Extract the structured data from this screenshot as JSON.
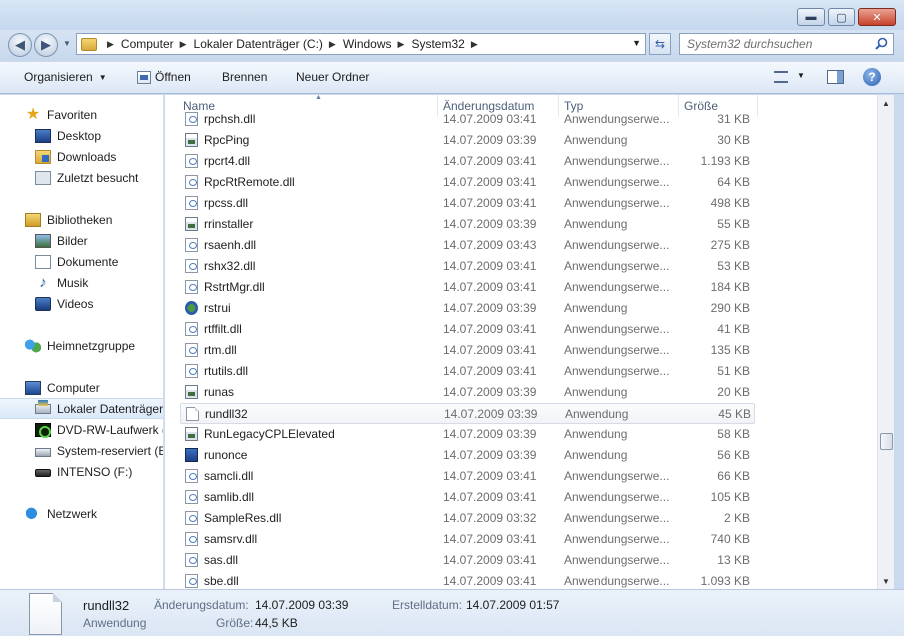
{
  "window": {
    "min_glyph": "▬",
    "max_glyph": "▢",
    "close_glyph": "✕"
  },
  "address": {
    "crumbs": [
      "Computer",
      "Lokaler Datenträger (C:)",
      "Windows",
      "System32"
    ],
    "search_placeholder": "System32 durchsuchen"
  },
  "toolbar": {
    "organize": "Organisieren",
    "open": "Öffnen",
    "burn": "Brennen",
    "new_folder": "Neuer Ordner",
    "help": "?"
  },
  "sidebar": {
    "favorites": "Favoriten",
    "desktop": "Desktop",
    "downloads": "Downloads",
    "recent": "Zuletzt besucht",
    "libraries": "Bibliotheken",
    "pictures": "Bilder",
    "documents": "Dokumente",
    "music": "Musik",
    "videos": "Videos",
    "homegroup": "Heimnetzgruppe",
    "computer": "Computer",
    "drive_c": "Lokaler Datenträger",
    "drive_dvd": "DVD-RW-Laufwerk (",
    "drive_sys": "System-reserviert (E:",
    "drive_f": "INTENSO (F:)",
    "network": "Netzwerk"
  },
  "columns": {
    "name": "Name",
    "date": "Änderungsdatum",
    "type": "Typ",
    "size": "Größe"
  },
  "files": [
    {
      "name": "rpchsh.dll",
      "date": "14.07.2009 03:41",
      "type": "Anwendungserwe...",
      "size": "31 KB",
      "icon": "dll-icon"
    },
    {
      "name": "RpcPing",
      "date": "14.07.2009 03:39",
      "type": "Anwendung",
      "size": "30 KB",
      "icon": "exe-icon"
    },
    {
      "name": "rpcrt4.dll",
      "date": "14.07.2009 03:41",
      "type": "Anwendungserwe...",
      "size": "1.193 KB",
      "icon": "dll-icon"
    },
    {
      "name": "RpcRtRemote.dll",
      "date": "14.07.2009 03:41",
      "type": "Anwendungserwe...",
      "size": "64 KB",
      "icon": "dll-icon"
    },
    {
      "name": "rpcss.dll",
      "date": "14.07.2009 03:41",
      "type": "Anwendungserwe...",
      "size": "498 KB",
      "icon": "dll-icon"
    },
    {
      "name": "rrinstaller",
      "date": "14.07.2009 03:39",
      "type": "Anwendung",
      "size": "55 KB",
      "icon": "exe-icon"
    },
    {
      "name": "rsaenh.dll",
      "date": "14.07.2009 03:43",
      "type": "Anwendungserwe...",
      "size": "275 KB",
      "icon": "dll-icon"
    },
    {
      "name": "rshx32.dll",
      "date": "14.07.2009 03:41",
      "type": "Anwendungserwe...",
      "size": "53 KB",
      "icon": "dll-icon"
    },
    {
      "name": "RstrtMgr.dll",
      "date": "14.07.2009 03:41",
      "type": "Anwendungserwe...",
      "size": "184 KB",
      "icon": "dll-icon"
    },
    {
      "name": "rstrui",
      "date": "14.07.2009 03:39",
      "type": "Anwendung",
      "size": "290 KB",
      "icon": "restore-icon"
    },
    {
      "name": "rtffilt.dll",
      "date": "14.07.2009 03:41",
      "type": "Anwendungserwe...",
      "size": "41 KB",
      "icon": "dll-icon"
    },
    {
      "name": "rtm.dll",
      "date": "14.07.2009 03:41",
      "type": "Anwendungserwe...",
      "size": "135 KB",
      "icon": "dll-icon"
    },
    {
      "name": "rtutils.dll",
      "date": "14.07.2009 03:41",
      "type": "Anwendungserwe...",
      "size": "51 KB",
      "icon": "dll-icon"
    },
    {
      "name": "runas",
      "date": "14.07.2009 03:39",
      "type": "Anwendung",
      "size": "20 KB",
      "icon": "exe-icon"
    },
    {
      "name": "rundll32",
      "date": "14.07.2009 03:39",
      "type": "Anwendung",
      "size": "45 KB",
      "icon": "blank-file-icon",
      "selected": true
    },
    {
      "name": "RunLegacyCPLElevated",
      "date": "14.07.2009 03:39",
      "type": "Anwendung",
      "size": "58 KB",
      "icon": "exe-icon"
    },
    {
      "name": "runonce",
      "date": "14.07.2009 03:39",
      "type": "Anwendung",
      "size": "56 KB",
      "icon": "runonce-icon"
    },
    {
      "name": "samcli.dll",
      "date": "14.07.2009 03:41",
      "type": "Anwendungserwe...",
      "size": "66 KB",
      "icon": "dll-icon"
    },
    {
      "name": "samlib.dll",
      "date": "14.07.2009 03:41",
      "type": "Anwendungserwe...",
      "size": "105 KB",
      "icon": "dll-icon"
    },
    {
      "name": "SampleRes.dll",
      "date": "14.07.2009 03:32",
      "type": "Anwendungserwe...",
      "size": "2 KB",
      "icon": "dll-icon"
    },
    {
      "name": "samsrv.dll",
      "date": "14.07.2009 03:41",
      "type": "Anwendungserwe...",
      "size": "740 KB",
      "icon": "dll-icon"
    },
    {
      "name": "sas.dll",
      "date": "14.07.2009 03:41",
      "type": "Anwendungserwe...",
      "size": "13 KB",
      "icon": "dll-icon"
    },
    {
      "name": "sbe.dll",
      "date": "14.07.2009 03:41",
      "type": "Anwendungserwe...",
      "size": "1.093 KB",
      "icon": "dll-icon"
    }
  ],
  "details": {
    "name": "rundll32",
    "type": "Anwendung",
    "modified_label": "Änderungsdatum:",
    "modified": "14.07.2009 03:39",
    "created_label": "Erstelldatum:",
    "created": "14.07.2009 01:57",
    "size_label": "Größe:",
    "size": "44,5 KB"
  }
}
